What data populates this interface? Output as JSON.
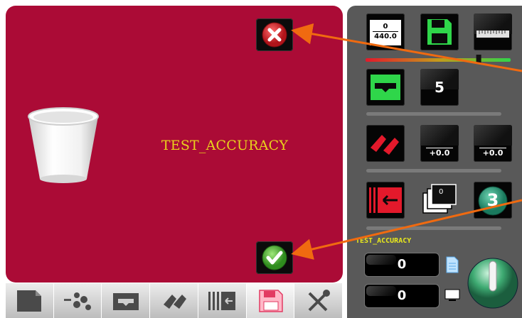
{
  "dialog": {
    "message": "TEST_ACCURACY",
    "close_icon": "close-icon",
    "confirm_icon": "check-icon",
    "bin_icon": "trash-bin-icon"
  },
  "tabs": [
    {
      "icon": "page-icon",
      "active": false
    },
    {
      "icon": "feeder-icon",
      "active": false
    },
    {
      "icon": "tray-icon",
      "active": false
    },
    {
      "icon": "transport-icon",
      "active": false
    },
    {
      "icon": "edge-icon",
      "active": false
    },
    {
      "icon": "save-icon",
      "active": true
    },
    {
      "icon": "tools-icon",
      "active": false
    }
  ],
  "panel": {
    "format_top": "0",
    "format_bottom": "440.0",
    "counter": "5",
    "offset_1": "+0.0",
    "offset_2": "+0.0",
    "stack_count": "0",
    "mode_number": "3",
    "label": "TEST_ACCURACY",
    "field_1": "0",
    "field_2": "0",
    "slider_level": 0.78
  },
  "colors": {
    "dialog_bg": "#ab0b36",
    "message": "#e8d21d",
    "panel_bg": "#595959",
    "accent_green": "#2fd64a",
    "accent_red": "#e3192b",
    "arrow": "#f06a10"
  }
}
